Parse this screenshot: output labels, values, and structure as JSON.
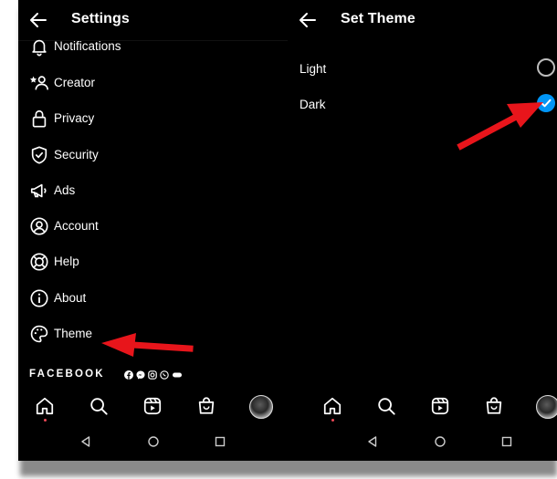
{
  "settings_screen": {
    "title": "Settings",
    "menu": [
      {
        "label": "Notifications",
        "icon": "bell-icon"
      },
      {
        "label": "Creator",
        "icon": "star-person-icon"
      },
      {
        "label": "Privacy",
        "icon": "lock-icon"
      },
      {
        "label": "Security",
        "icon": "shield-icon"
      },
      {
        "label": "Ads",
        "icon": "megaphone-icon"
      },
      {
        "label": "Account",
        "icon": "person-circle-icon"
      },
      {
        "label": "Help",
        "icon": "lifebuoy-icon"
      },
      {
        "label": "About",
        "icon": "info-icon"
      },
      {
        "label": "Theme",
        "icon": "palette-icon"
      }
    ],
    "footer_brand": "FACEBOOK",
    "footer_brand_icons": [
      "facebook-icon",
      "messenger-icon",
      "instagram-icon",
      "whatsapp-icon",
      "portal-icon"
    ]
  },
  "theme_screen": {
    "title": "Set Theme",
    "options": [
      {
        "label": "Light",
        "selected": false
      },
      {
        "label": "Dark",
        "selected": true
      }
    ]
  },
  "bottom_nav": [
    "home-icon",
    "search-icon",
    "reels-icon",
    "shop-icon",
    "profile-avatar"
  ],
  "system_nav": [
    "back-triangle-icon",
    "home-circle-icon",
    "recents-square-icon"
  ],
  "colors": {
    "background": "#000000",
    "text": "#ffffff",
    "accent_check": "#0095f6",
    "annotation_arrow": "#e8151b",
    "notification_dot": "#ed4956"
  }
}
